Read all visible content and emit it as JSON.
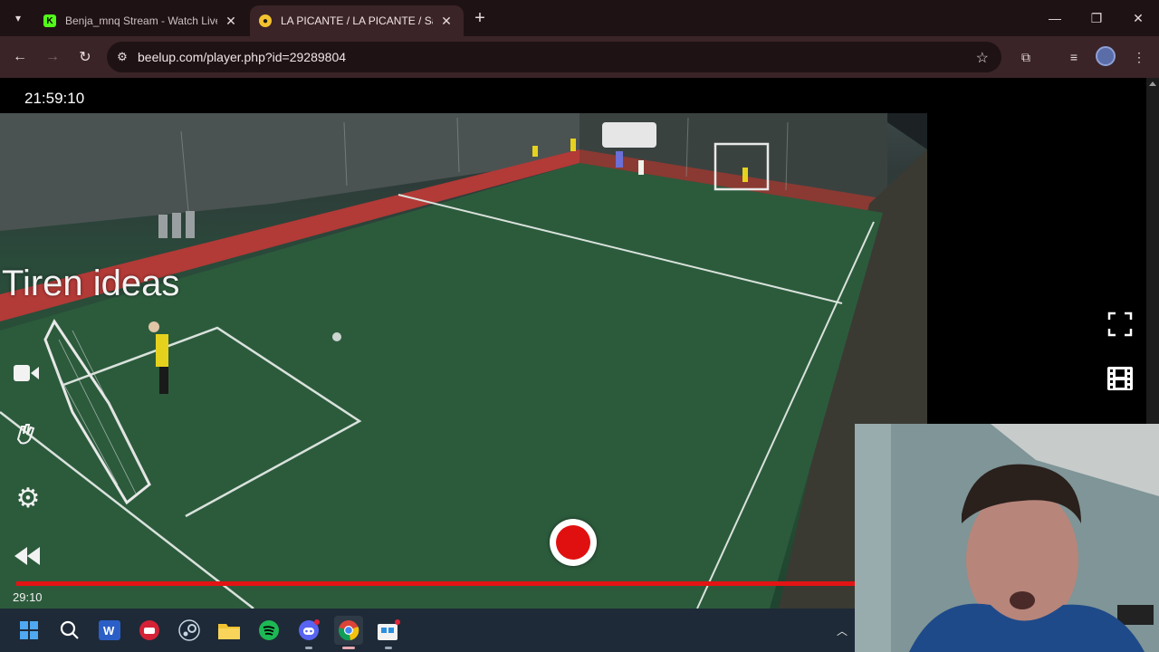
{
  "browser": {
    "tabs": [
      {
        "title": "Benja_mnq Stream - Watch Live",
        "favicon": "kick-icon",
        "favicon_color": "#53fc18",
        "active": false
      },
      {
        "title": "LA PICANTE / LA PICANTE / Sáb",
        "favicon": "beelup-icon",
        "favicon_color": "#f2c230",
        "active": true
      }
    ],
    "address": "beelup.com/player.php?id=29289804"
  },
  "player": {
    "clock": "21:59:10",
    "overlay_text": "Tiren ideas",
    "timecode": "29:10",
    "progress_fraction": 1.0,
    "accent": "#e31414"
  },
  "taskbar": {
    "apps": [
      "windows-start",
      "search",
      "word",
      "app-red",
      "steam",
      "file-explorer",
      "spotify",
      "discord",
      "chrome",
      "store"
    ]
  }
}
